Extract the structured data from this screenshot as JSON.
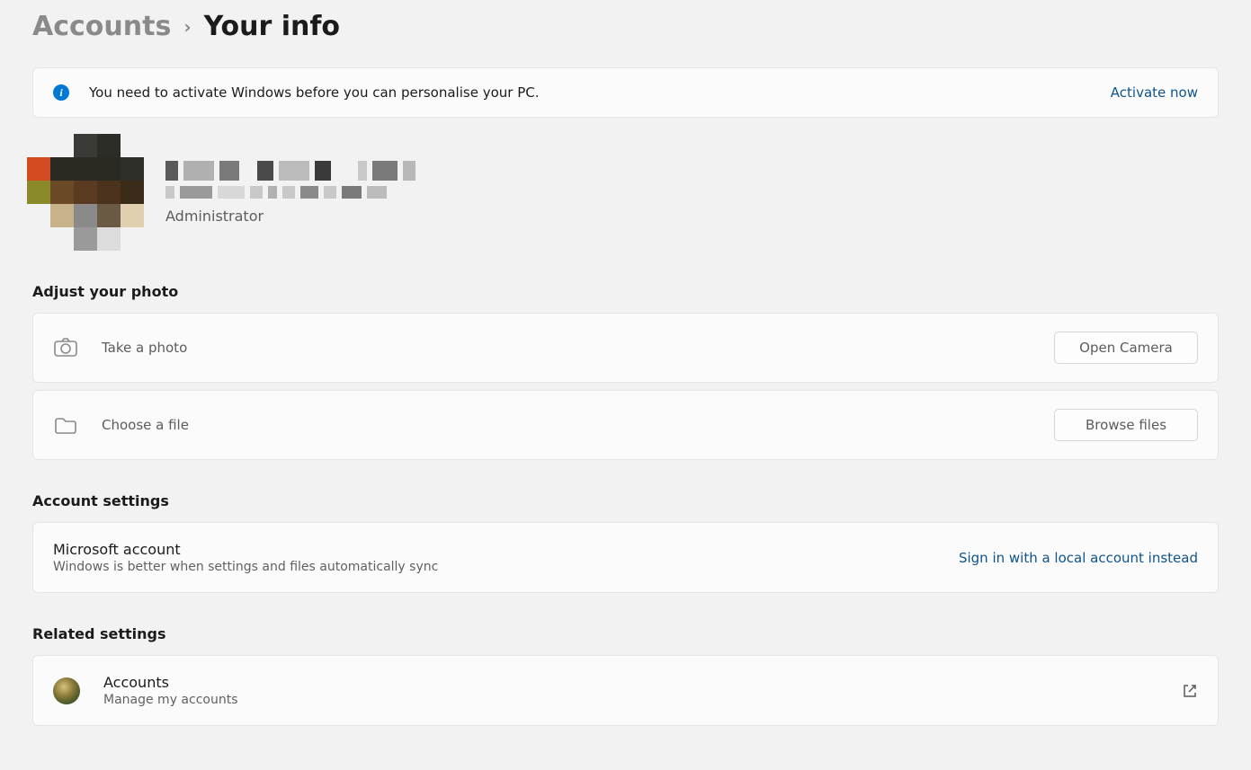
{
  "breadcrumb": {
    "parent": "Accounts",
    "current": "Your info"
  },
  "banner": {
    "message": "You need to activate Windows before you can personalise your PC.",
    "action": "Activate now"
  },
  "profile": {
    "name_redacted": true,
    "email_redacted": true,
    "role": "Administrator"
  },
  "sections": {
    "adjust_photo": {
      "heading": "Adjust your photo",
      "take_photo_label": "Take a photo",
      "take_photo_button": "Open Camera",
      "choose_file_label": "Choose a file",
      "choose_file_button": "Browse files"
    },
    "account_settings": {
      "heading": "Account settings",
      "ms_account_title": "Microsoft account",
      "ms_account_desc": "Windows is better when settings and files automatically sync",
      "action": "Sign in with a local account instead"
    },
    "related": {
      "heading": "Related settings",
      "accounts_title": "Accounts",
      "accounts_desc": "Manage my accounts"
    }
  }
}
